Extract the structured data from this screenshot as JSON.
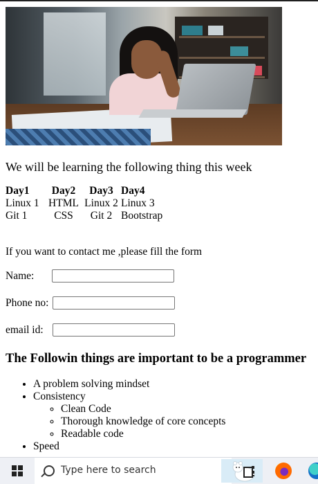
{
  "intro": "We will be learning the following thing this week",
  "schedule": {
    "headers": [
      "Day1",
      "Day2",
      "Day3",
      "Day4"
    ],
    "rows": [
      [
        "Linux 1",
        "HTML",
        "Linux 2",
        "Linux 3"
      ],
      [
        "Git 1",
        "CSS",
        "Git 2",
        "Bootstrap"
      ]
    ]
  },
  "contact_note": "If you want to contact me ,please fill the form",
  "form": {
    "name_label": "Name:",
    "phone_label": "Phone no:",
    "email_label": "email id:",
    "name_value": "",
    "phone_value": "",
    "email_value": ""
  },
  "heading": "The Followin things are important to be a programmer",
  "list": {
    "item1": "A problem solving mindset",
    "item2": "Consistency",
    "sub1": "Clean Code",
    "sub2": "Thorough knowledge of core concepts",
    "sub3": "Readable code",
    "item3": "Speed"
  },
  "taskbar": {
    "search_placeholder": "Type here to search",
    "icons": [
      "windows-start-icon",
      "search-icon",
      "task-view-icon",
      "firefox-icon",
      "edge-icon"
    ]
  },
  "colors": {
    "taskbar_bg": "#eef0f5",
    "text": "#000000"
  }
}
